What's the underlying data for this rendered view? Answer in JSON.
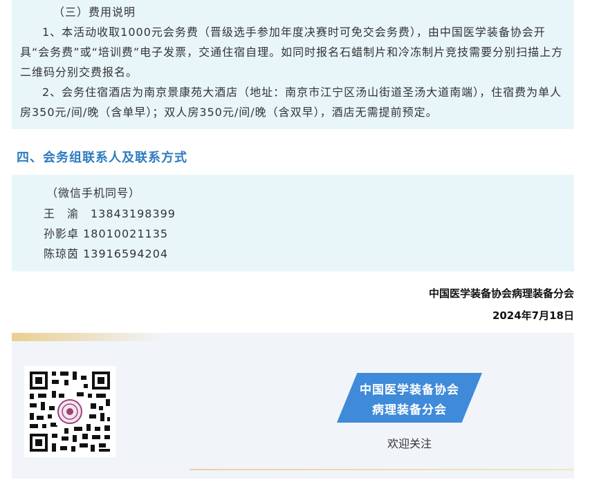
{
  "fees": {
    "title": "（三）费用说明",
    "item1": "1、本活动收取1000元会务费（晋级选手参加年度决赛时可免交会务费），由中国医学装备协会开具“会务费”或“培训费”电子发票，交通住宿自理。如同时报名石蜡制片和冷冻制片竞技需要分别扫描上方二维码分别交费报名。",
    "item2": "2、会务住宿酒店为南京景康苑大酒店（地址：南京市江宁区汤山街道圣汤大道南端），住宿费为单人房350元/间/晚（含单早）；双人房350元/间/晚（含双早），酒店无需提前预定。"
  },
  "contacts": {
    "heading": "四、会务组联系人及联系方式",
    "note": "（微信手机同号）",
    "people": [
      {
        "line": "王　渝　13843198399"
      },
      {
        "line": "孙影卓 18010021135"
      },
      {
        "line": "陈琼茵 13916594204"
      }
    ]
  },
  "signature": {
    "org": "中国医学装备协会病理装备分会",
    "date": "2024年7月18日"
  },
  "footer": {
    "badge_line1": "中国医学装备协会",
    "badge_line2": "病理装备分会",
    "follow_text": "欢迎关注",
    "qr_icon": "qr-code-icon",
    "accent_blue": "#3f8ad9",
    "accent_gold": "#e9cf92"
  }
}
